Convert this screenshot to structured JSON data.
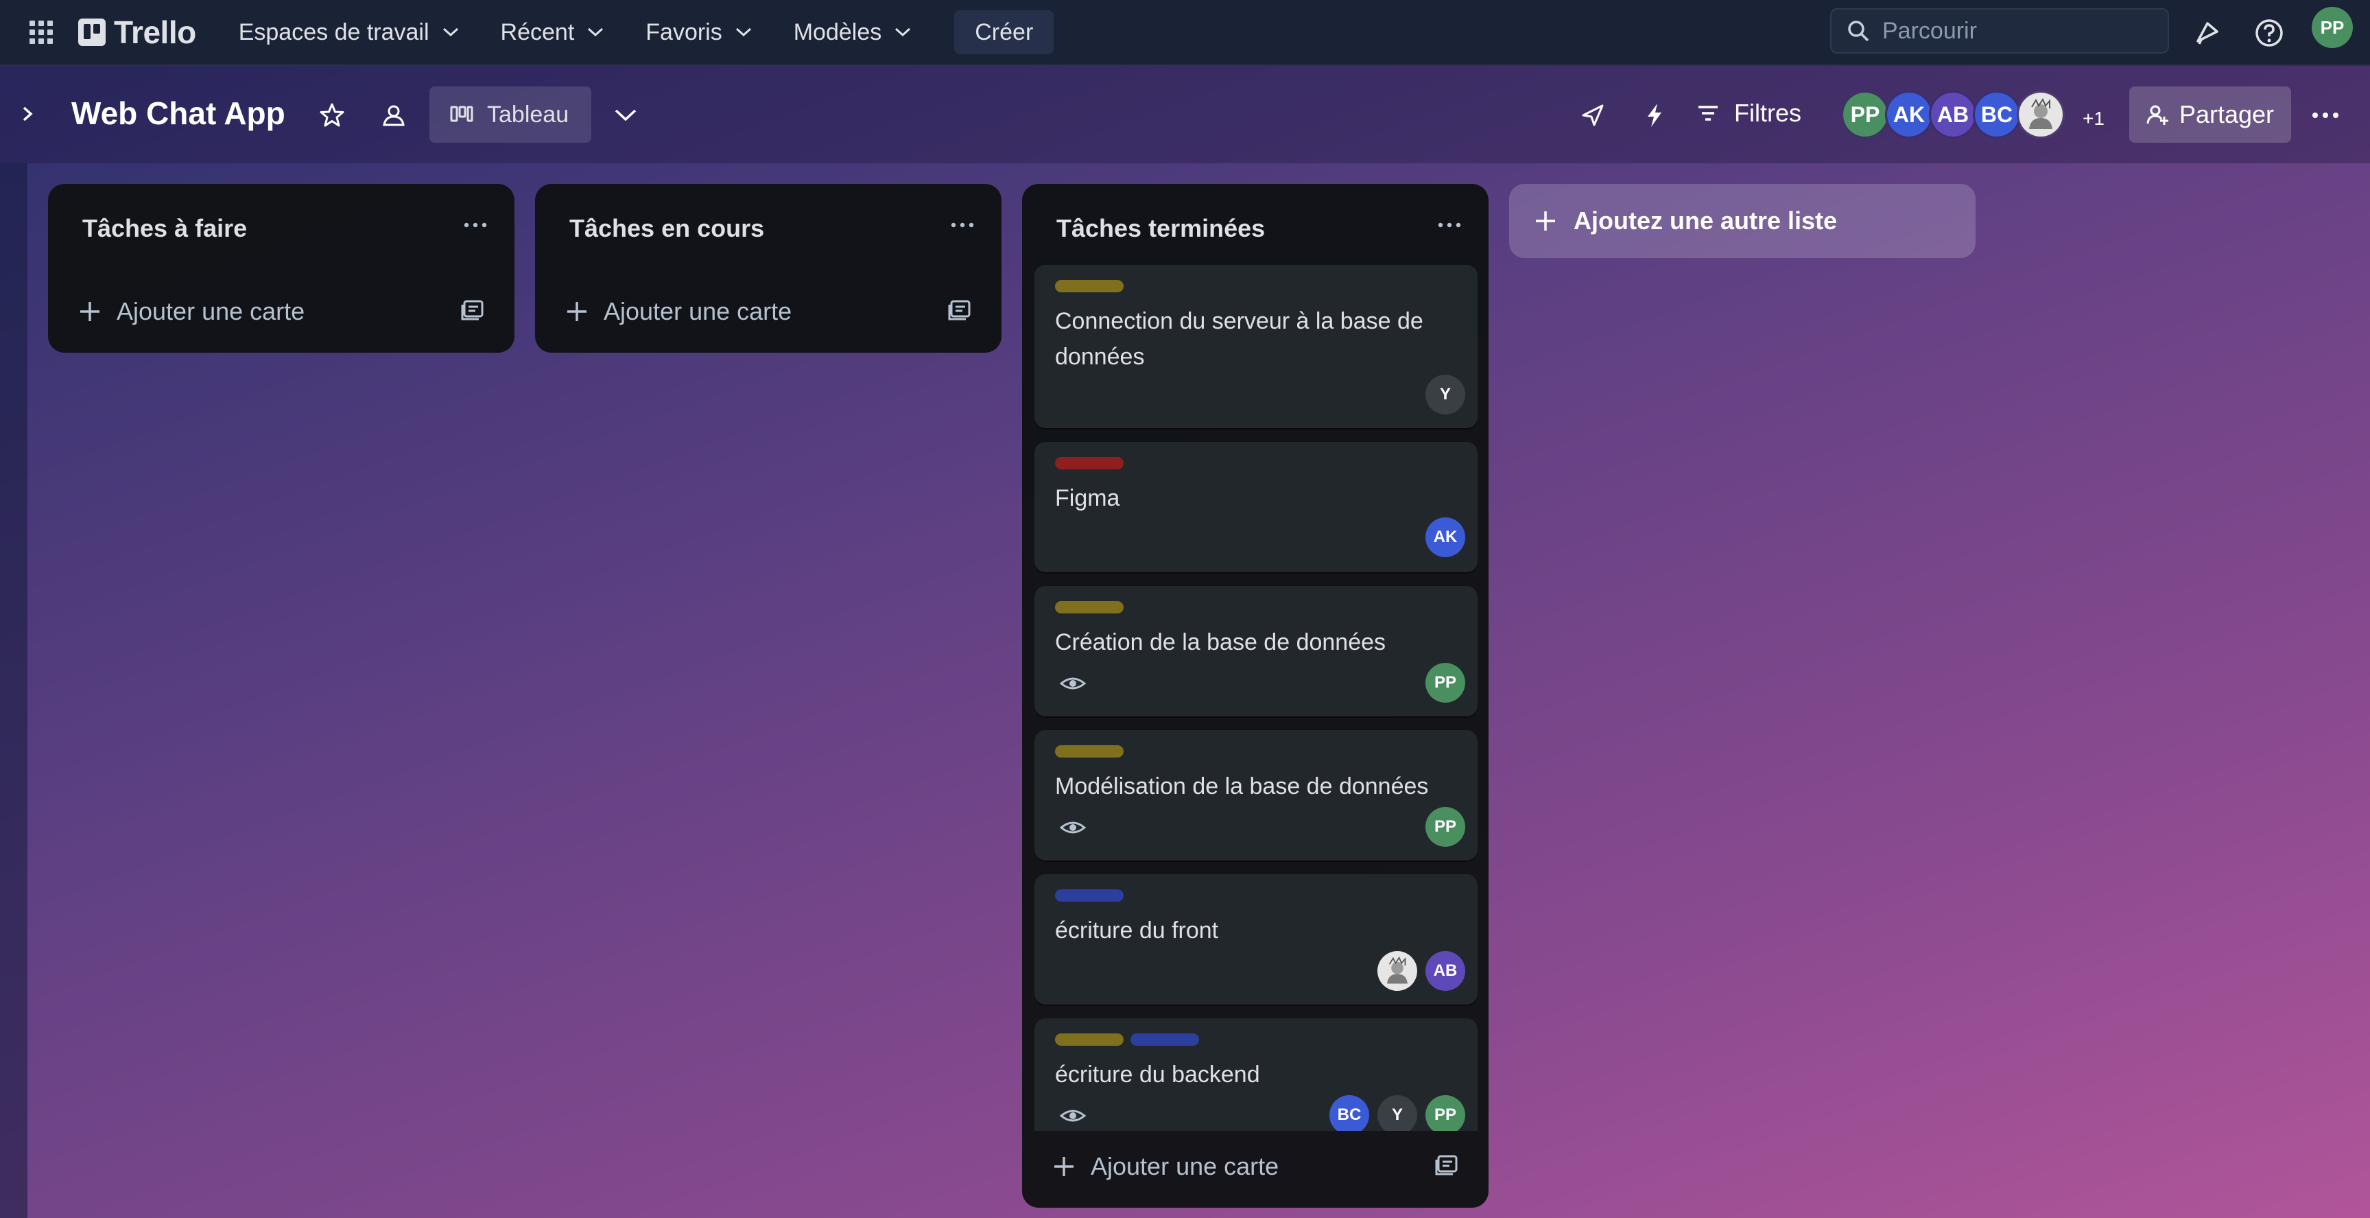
{
  "topnav": {
    "logo_text": "Trello",
    "menus": [
      {
        "label": "Espaces de travail"
      },
      {
        "label": "Récent"
      },
      {
        "label": "Favoris"
      },
      {
        "label": "Modèles"
      }
    ],
    "create_label": "Créer",
    "search_placeholder": "Parcourir",
    "user_initials": "PP",
    "icons": [
      "apps-grid-icon",
      "notifications-icon",
      "help-icon"
    ]
  },
  "board": {
    "title": "Web Chat App",
    "view_label": "Tableau",
    "filters_label": "Filtres",
    "share_label": "Partager",
    "members": [
      {
        "initials": "PP",
        "color": "#4a8f5f"
      },
      {
        "initials": "AK",
        "color": "#3b5bd6"
      },
      {
        "initials": "AB",
        "color": "#5f49b8"
      },
      {
        "initials": "BC",
        "color": "#3b5bd6"
      },
      {
        "initials": "",
        "color": "#e6e6e6"
      }
    ],
    "members_extra": "+1"
  },
  "lists": [
    {
      "title": "Tâches à faire",
      "add_card_label": "Ajouter une carte"
    },
    {
      "title": "Tâches en cours",
      "add_card_label": "Ajouter une carte"
    },
    {
      "title": "Tâches terminées",
      "add_card_label": "Ajouter une carte",
      "cards": [
        {
          "title": "Connection du serveur à la base de données",
          "labels": [
            "#7f6f1f"
          ],
          "watched": false,
          "members": [
            {
              "initials": "Y",
              "color": "#3a3f45"
            }
          ]
        },
        {
          "title": "Figma",
          "labels": [
            "#8f1f1f"
          ],
          "watched": false,
          "members": [
            {
              "initials": "AK",
              "color": "#3b5bd6"
            }
          ]
        },
        {
          "title": "Création de la base de données",
          "labels": [
            "#7f6f1f"
          ],
          "watched": true,
          "members": [
            {
              "initials": "PP",
              "color": "#4a8f5f"
            }
          ]
        },
        {
          "title": "Modélisation de la base de données",
          "labels": [
            "#7f6f1f"
          ],
          "watched": true,
          "members": [
            {
              "initials": "PP",
              "color": "#4a8f5f"
            }
          ]
        },
        {
          "title": "écriture du front",
          "labels": [
            "#2c3f9f"
          ],
          "watched": false,
          "members": [
            {
              "initials": "",
              "color": "#e6e6e6"
            },
            {
              "initials": "AB",
              "color": "#5f49b8"
            }
          ]
        },
        {
          "title": "écriture du backend",
          "labels": [
            "#7f6f1f",
            "#2c3f9f"
          ],
          "watched": true,
          "members": [
            {
              "initials": "BC",
              "color": "#3b5bd6"
            },
            {
              "initials": "Y",
              "color": "#3a3f45"
            },
            {
              "initials": "PP",
              "color": "#4a8f5f"
            }
          ]
        }
      ]
    }
  ],
  "add_list_label": "Ajoutez une autre liste"
}
